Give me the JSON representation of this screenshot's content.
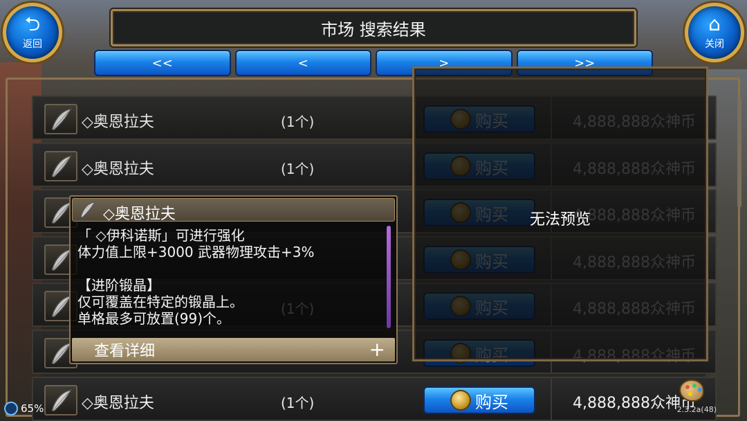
{
  "header": {
    "title": "市场 搜索结果",
    "back_label": "返回",
    "close_label": "关闭"
  },
  "pager": [
    "<<",
    "<",
    ">",
    ">>"
  ],
  "rows": [
    {
      "name": "◇奥恩拉夫",
      "qty": "(1个)",
      "buy": "购买",
      "price": "4,888,888众神币",
      "dimmed": true
    },
    {
      "name": "◇奥恩拉夫",
      "qty": "(1个)",
      "buy": "购买",
      "price": "4,888,888众神币",
      "dimmed": true
    },
    {
      "name": "",
      "qty": "",
      "buy": "购买",
      "price": "4,888,888众神币",
      "dimmed": true
    },
    {
      "name": "",
      "qty": "",
      "buy": "购买",
      "price": "4,888,888众神币",
      "dimmed": true
    },
    {
      "name": "",
      "qty": "(1个)",
      "buy": "购买",
      "price": "4,888,888众神币",
      "dimmed": true
    },
    {
      "name": "",
      "qty": "",
      "buy": "购买",
      "price": "4,888,888众神币",
      "dimmed": true
    },
    {
      "name": "◇奥恩拉夫",
      "qty": "(1个)",
      "buy": "购买",
      "price": "4,888,888众神币",
      "dimmed": false
    }
  ],
  "preview": {
    "text": "无法预览"
  },
  "tooltip": {
    "title": "◇奥恩拉夫",
    "lines": [
      "「 ◇伊科诺斯」可进行强化",
      "体力值上限+3000 武器物理攻击+3%",
      "",
      "【进阶锻晶】",
      "仅可覆盖在特定的锻晶上。",
      "单格最多可放置(99)个。"
    ],
    "footer": "查看详细",
    "footer_plus": "+"
  },
  "hud": {
    "battery": "65%",
    "version": "2.3.2a(48)"
  }
}
